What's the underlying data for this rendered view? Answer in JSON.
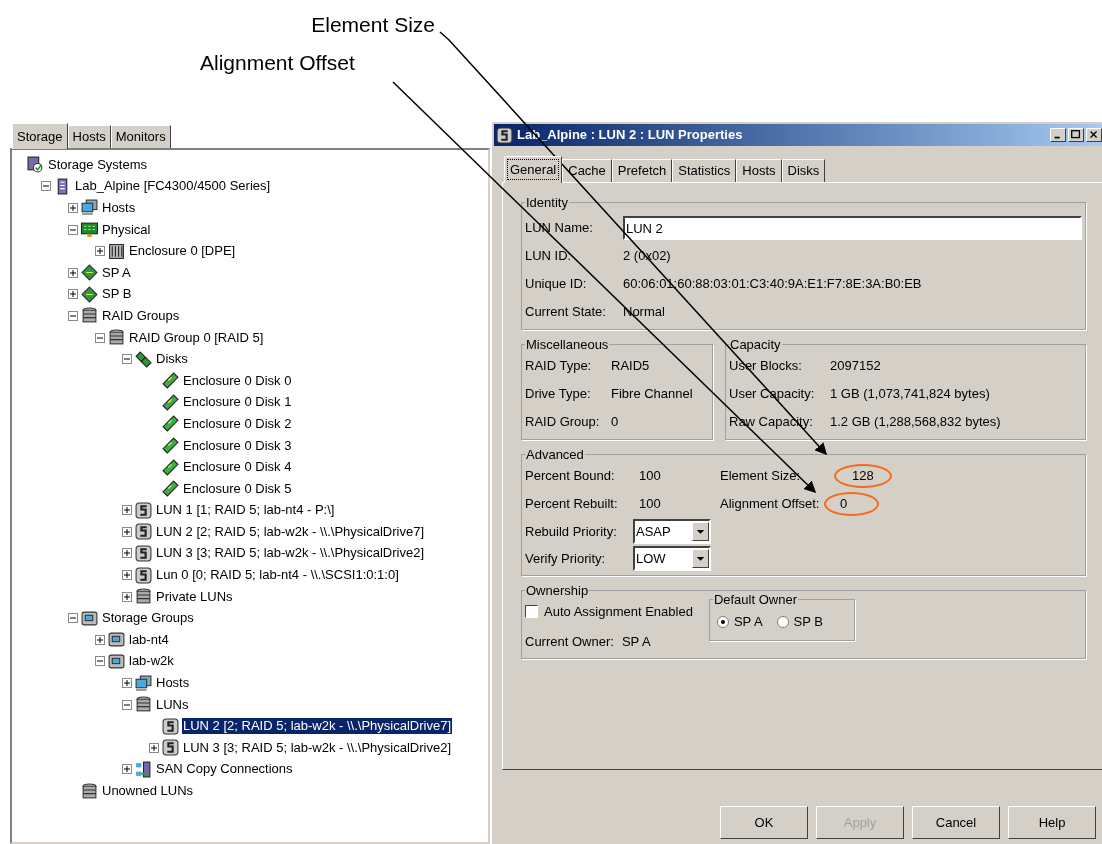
{
  "annotations": [
    {
      "label": "Element Size"
    },
    {
      "label": "Alignment Offset"
    }
  ],
  "left_tabs": [
    {
      "label": "Storage",
      "selected": true
    },
    {
      "label": "Hosts",
      "selected": false
    },
    {
      "label": "Monitors",
      "selected": false
    }
  ],
  "tree": [
    {
      "label": "Storage Systems",
      "kind": "systems",
      "selected": false,
      "children": [
        {
          "label": "Lab_Alpine [FC4300/4500 Series]",
          "kind": "array",
          "expanded": true,
          "selected": false,
          "children": [
            {
              "label": "Hosts",
              "kind": "hosts",
              "expanded": false,
              "selected": false
            },
            {
              "label": "Physical",
              "kind": "physical",
              "expanded": true,
              "selected": false,
              "children": [
                {
                  "label": "Enclosure 0 [DPE]",
                  "kind": "enclosure",
                  "expanded": false,
                  "selected": false
                }
              ]
            },
            {
              "label": "SP A",
              "kind": "sp",
              "expanded": false,
              "selected": false
            },
            {
              "label": "SP B",
              "kind": "sp",
              "expanded": false,
              "selected": false
            },
            {
              "label": "RAID Groups",
              "kind": "stack",
              "expanded": true,
              "selected": false,
              "children": [
                {
                  "label": "RAID Group 0 [RAID 5]",
                  "kind": "stack",
                  "expanded": true,
                  "selected": false,
                  "children": [
                    {
                      "label": "Disks",
                      "kind": "disks",
                      "expanded": true,
                      "selected": false,
                      "children": [
                        {
                          "label": "Enclosure 0 Disk 0",
                          "kind": "disk",
                          "selected": false
                        },
                        {
                          "label": "Enclosure 0 Disk 1",
                          "kind": "disk",
                          "selected": false
                        },
                        {
                          "label": "Enclosure 0 Disk 2",
                          "kind": "disk",
                          "selected": false
                        },
                        {
                          "label": "Enclosure 0 Disk 3",
                          "kind": "disk",
                          "selected": false
                        },
                        {
                          "label": "Enclosure 0 Disk 4",
                          "kind": "disk",
                          "selected": false
                        },
                        {
                          "label": "Enclosure 0 Disk 5",
                          "kind": "disk",
                          "selected": false
                        }
                      ]
                    },
                    {
                      "label": "LUN 1 [1; RAID 5; lab-nt4 - P:\\]",
                      "kind": "lun",
                      "expanded": false,
                      "selected": false
                    },
                    {
                      "label": "LUN 2 [2; RAID 5; lab-w2k - \\\\.\\PhysicalDrive7]",
                      "kind": "lun",
                      "expanded": false,
                      "selected": false
                    },
                    {
                      "label": "LUN 3 [3; RAID 5; lab-w2k - \\\\.\\PhysicalDrive2]",
                      "kind": "lun",
                      "expanded": false,
                      "selected": false
                    },
                    {
                      "label": "Lun 0 [0; RAID 5; lab-nt4 - \\\\.\\SCSI1:0:1:0]",
                      "kind": "lun",
                      "expanded": false,
                      "selected": false
                    },
                    {
                      "label": "Private LUNs",
                      "kind": "stack",
                      "expanded": false,
                      "selected": false
                    }
                  ]
                }
              ]
            },
            {
              "label": "Storage Groups",
              "kind": "group",
              "expanded": true,
              "selected": false,
              "children": [
                {
                  "label": "lab-nt4",
                  "kind": "group",
                  "expanded": false,
                  "selected": false
                },
                {
                  "label": "lab-w2k",
                  "kind": "group",
                  "expanded": true,
                  "selected": false,
                  "children": [
                    {
                      "label": "Hosts",
                      "kind": "hosts",
                      "expanded": false,
                      "selected": false
                    },
                    {
                      "label": "LUNs",
                      "kind": "stack",
                      "expanded": true,
                      "selected": false,
                      "children": [
                        {
                          "label": "LUN 2 [2; RAID 5; lab-w2k - \\\\.\\PhysicalDrive7]",
                          "kind": "lun",
                          "selected": true
                        },
                        {
                          "label": "LUN 3 [3; RAID 5; lab-w2k - \\\\.\\PhysicalDrive2]",
                          "kind": "lun",
                          "expanded": false,
                          "selected": false
                        }
                      ]
                    },
                    {
                      "label": "SAN Copy Connections",
                      "kind": "sancopy",
                      "expanded": false,
                      "selected": false
                    }
                  ]
                }
              ]
            },
            {
              "label": "Unowned LUNs",
              "kind": "stack",
              "selected": false
            }
          ]
        }
      ]
    }
  ],
  "dialog": {
    "title": "Lab_Alpine : LUN 2 : LUN Properties",
    "tabs": [
      {
        "label": "General",
        "selected": true
      },
      {
        "label": "Cache",
        "selected": false
      },
      {
        "label": "Prefetch",
        "selected": false
      },
      {
        "label": "Statistics",
        "selected": false
      },
      {
        "label": "Hosts",
        "selected": false
      },
      {
        "label": "Disks",
        "selected": false
      }
    ],
    "identity": {
      "title": "Identity",
      "name_label": "LUN Name:",
      "name_value": "LUN 2",
      "rows": [
        {
          "label": "LUN ID:",
          "value": "2 (0x02)"
        },
        {
          "label": "Unique ID:",
          "value": "60:06:01:60:88:03:01:C3:40:9A:E1:F7:8E:3A:B0:EB"
        },
        {
          "label": "Current State:",
          "value": "Normal"
        }
      ]
    },
    "miscellaneous": {
      "title": "Miscellaneous",
      "rows": [
        {
          "label": "RAID Type:",
          "value": "RAID5"
        },
        {
          "label": "Drive Type:",
          "value": "Fibre Channel"
        },
        {
          "label": "RAID Group:",
          "value": "0"
        }
      ]
    },
    "capacity": {
      "title": "Capacity",
      "rows": [
        {
          "label": "User Blocks:",
          "value": "2097152"
        },
        {
          "label": "User Capacity:",
          "value": "1 GB (1,073,741,824 bytes)"
        },
        {
          "label": "Raw Capacity:",
          "value": "1.2 GB (1,288,568,832 bytes)"
        }
      ]
    },
    "advanced": {
      "title": "Advanced",
      "left": [
        {
          "label": "Percent Bound:",
          "value": "100"
        },
        {
          "label": "Percent Rebuilt:",
          "value": "100"
        }
      ],
      "right": [
        {
          "label": "Element Size:",
          "value": "128"
        },
        {
          "label": "Alignment Offset:",
          "value": "0"
        }
      ],
      "dropdowns": [
        {
          "label": "Rebuild Priority:",
          "value": "ASAP"
        },
        {
          "label": "Verify Priority:",
          "value": "LOW"
        }
      ]
    },
    "ownership": {
      "title": "Ownership",
      "checkbox": {
        "label": "Auto Assignment Enabled",
        "checked": false
      },
      "current_owner_label": "Current Owner:",
      "current_owner": "SP A",
      "default_owner": {
        "title": "Default Owner",
        "options": [
          {
            "label": "SP A",
            "selected": true
          },
          {
            "label": "SP B",
            "selected": false
          }
        ]
      }
    },
    "buttons": [
      {
        "label": "OK",
        "disabled": false
      },
      {
        "label": "Apply",
        "disabled": true
      },
      {
        "label": "Cancel",
        "disabled": false
      },
      {
        "label": "Help",
        "disabled": false
      }
    ]
  }
}
